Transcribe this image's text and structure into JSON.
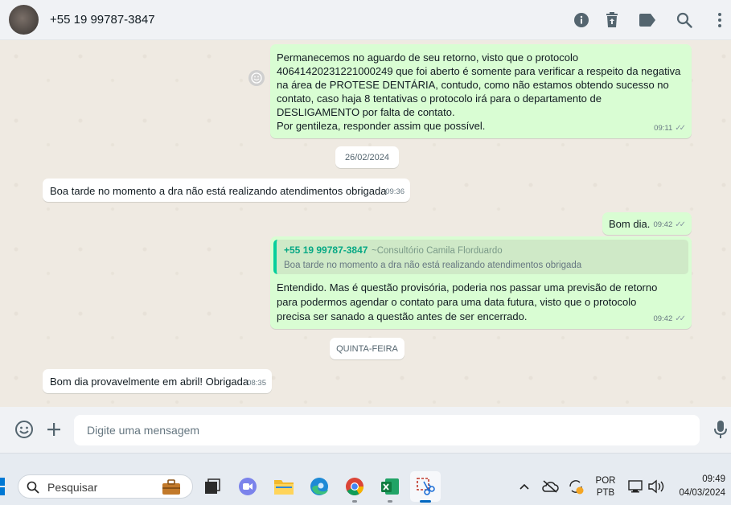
{
  "header": {
    "contact": "+55 19 99787-3847",
    "icons": [
      "info-icon",
      "trash-icon",
      "label-icon",
      "search-icon",
      "more-icon"
    ]
  },
  "messages": {
    "m1": {
      "text": "Permanecemos no aguardo de seu retorno, visto que o protocolo 40641420231221000249 que foi aberto é somente para verificar a respeito da negativa na área de PROTESE DENTÁRIA, contudo, como não estamos obtendo sucesso no contato, caso haja 8 tentativas o protocolo irá para o departamento de DESLIGAMENTO por falta de contato.",
      "text2": "Por gentileza, responder assim que possível.",
      "time": "09:11"
    },
    "date1": "26/02/2024",
    "m2": {
      "text": "Boa tarde no momento a dra não está realizando atendimentos obrigada",
      "time": "09:36"
    },
    "m3": {
      "text": "Bom dia.",
      "time": "09:42"
    },
    "m4": {
      "quote_author": "+55 19 99787-3847",
      "quote_sub": "~Consultório Camila Florduardo",
      "quote_text": "Boa tarde no momento a dra não está realizando atendimentos obrigada",
      "text": "Entendido. Mas é questão provisória, poderia nos passar uma previsão de retorno para podermos agendar o contato para uma data futura, visto que o protocolo precisa ser sanado a questão antes de ser encerrado.",
      "time": "09:42"
    },
    "date2": "QUINTA-FEIRA",
    "m5": {
      "text": "Bom dia provavelmente em abril! Obrigada",
      "time": "08:35"
    }
  },
  "composer": {
    "placeholder": "Digite uma mensagem"
  },
  "taskbar": {
    "search_label": "Pesquisar",
    "lang1": "POR",
    "lang2": "PTB",
    "time": "09:49",
    "date": "04/03/2024"
  },
  "colors": {
    "outgoing_bubble": "#d9fdd3",
    "incoming_bubble": "#ffffff",
    "quote_accent": "#06cf9c",
    "chat_bg": "#efeae2"
  }
}
